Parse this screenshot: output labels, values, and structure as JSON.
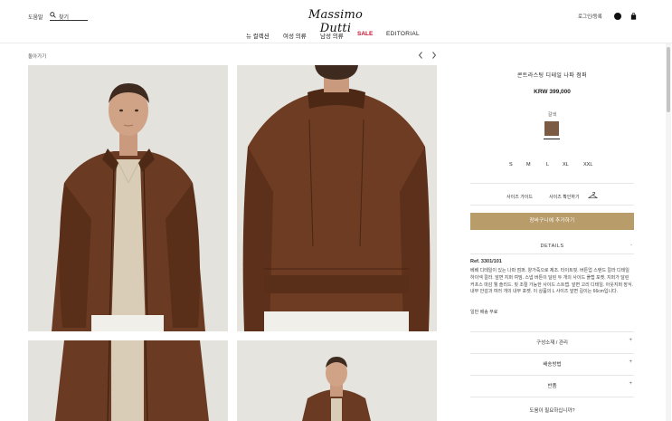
{
  "header": {
    "help_label": "도움말",
    "search_label": "찾기",
    "logo_text": "Massimo Dutti",
    "login_label": "로그인/등록",
    "nav": [
      "뉴 컬렉션",
      "여성 의류",
      "남성 의류",
      "SALE",
      "EDITORIAL"
    ]
  },
  "subbar": {
    "back_label": "돌아가기"
  },
  "gallery": {
    "icons": [
      "prev-arrow-icon",
      "next-arrow-icon"
    ],
    "photos": [
      "product-photo-front",
      "product-photo-back",
      "product-photo-detail",
      "product-photo-model"
    ]
  },
  "product": {
    "title": "콘트라스팅 디테일 나파 점퍼",
    "price": "KRW 399,000",
    "color_name": "갈색",
    "color_hex": "#7b5b44",
    "sizes": [
      "S",
      "M",
      "L",
      "XL",
      "XXL"
    ],
    "size_guide": "사이즈 가이드",
    "size_check": "사이즈 확인하기",
    "add_to_cart": "장바구니에 추가하기",
    "button_color": "#b89c6a"
  },
  "details": {
    "label": "DETAILS",
    "toggle": "-",
    "ref": "Ref. 3301/101",
    "description": "베베 디테일이 있는 나파 점퍼. 양가죽으로 제조. 타이트핏. 버튼업 스탠드 칼라 디테일 하이넥 칼라. 앞면 지퍼 여밈. 스냅 버튼이 달린 두 개의 사이드 플랩 포켓. 지퍼가 달린 커프스 마감 웰 솔리드. 핏 조절 가능한 사이드 스트랩. 앞면 고리 디테일. 아웃지퍼 장식. 내부 안감과 여러 개의 내부 포켓. 이 상품의 L 사이즈 앞면 길이는 66cm입니다.",
    "shipping_note": "일반 배송 무료"
  },
  "accordion": [
    {
      "label": "구성소재 / 관리",
      "icon": "+"
    },
    {
      "label": "배송방법",
      "icon": "+"
    },
    {
      "label": "반품",
      "icon": "+"
    }
  ],
  "help_question": "도움이 필요하십니까?"
}
